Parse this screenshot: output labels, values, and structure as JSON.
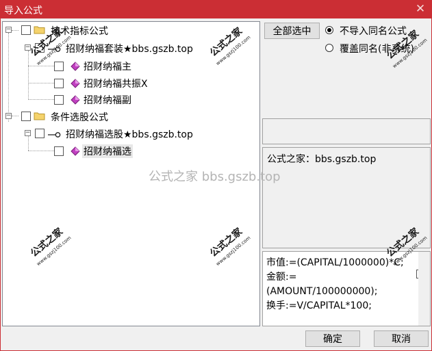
{
  "window": {
    "title": "导入公式",
    "close_glyph": "✕"
  },
  "tree": {
    "nodes": [
      {
        "label": "技术指标公式",
        "kind": "folder",
        "expander": "−"
      },
      {
        "label": "招财纳福套装★bbs.gszb.top",
        "kind": "key",
        "expander": "−"
      },
      {
        "label": "招财纳福主",
        "kind": "formula"
      },
      {
        "label": "招财纳福共振X",
        "kind": "formula"
      },
      {
        "label": "招财纳福副",
        "kind": "formula"
      },
      {
        "label": "条件选股公式",
        "kind": "folder",
        "expander": "−"
      },
      {
        "label": "招财纳福选股★bbs.gszb.top",
        "kind": "key",
        "expander": "−"
      },
      {
        "label": "招财纳福选",
        "kind": "formula",
        "selected": true
      }
    ]
  },
  "options": {
    "select_all_label": "全部选中",
    "radio_no_import_label": "不导入同名公式",
    "radio_overwrite_label": "覆盖同名(非系统)",
    "selected_radio": "no_import"
  },
  "description": {
    "text": "公式之家：bbs.gszb.top"
  },
  "code": {
    "text": "市值:=(CAPITAL/1000000)*C;\n金额:=\n(AMOUNT/100000000);\n换手:=V/CAPITAL*100;"
  },
  "footer": {
    "ok_label": "确定",
    "cancel_label": "取消"
  },
  "watermark": {
    "center_text": "公式之家 bbs.gszb.top",
    "stamp_text": "公式之家",
    "stamp_url": "www.gszj100.com"
  },
  "colors": {
    "title_bar": "#cb2e34",
    "folder": "#f5d36c",
    "formula_diamond": "#c040c0"
  },
  "icons": {
    "folder": "folder-icon",
    "key": "key-icon",
    "formula": "diamond-icon",
    "close": "close-icon"
  }
}
